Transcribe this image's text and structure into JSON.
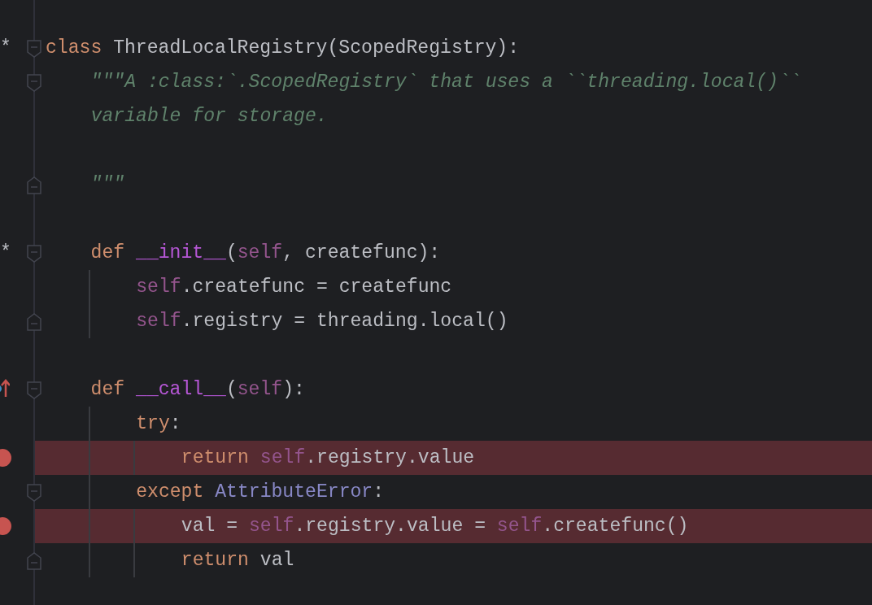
{
  "editor": {
    "lines": [
      {
        "kind": "code",
        "gutter": "*",
        "fold": {
          "kind": "start"
        },
        "tokens": [
          {
            "kind": "keyword",
            "text": "class"
          },
          {
            "kind": "plain",
            "text": " ThreadLocalRegistry(ScopedRegistry):"
          }
        ],
        "children": [
          {
            "kind": "code",
            "fold": {
              "kind": "start"
            },
            "tokens": [
              {
                "kind": "doc",
                "text": "\"\"\"A :class:`.ScopedRegistry` that uses a ``threading.local()``"
              }
            ]
          },
          {
            "kind": "code",
            "tokens": [
              {
                "kind": "doc",
                "text": "variable for storage."
              }
            ]
          },
          {
            "kind": "blank"
          },
          {
            "kind": "code",
            "fold": {
              "kind": "end"
            },
            "tokens": [
              {
                "kind": "doc",
                "text": "\"\"\""
              }
            ]
          },
          {
            "kind": "blank"
          },
          {
            "kind": "code",
            "gutter": "*",
            "fold": {
              "kind": "start"
            },
            "tokens": [
              {
                "kind": "keyword",
                "text": "def "
              },
              {
                "kind": "dunder",
                "text": "__init__"
              },
              {
                "kind": "plain",
                "text": "("
              },
              {
                "kind": "self",
                "text": "self"
              },
              {
                "kind": "plain",
                "text": ", createfunc):"
              }
            ],
            "children": [
              {
                "kind": "code",
                "tokens": [
                  {
                    "kind": "self",
                    "text": "self"
                  },
                  {
                    "kind": "plain",
                    "text": ".createfunc = createfunc"
                  }
                ]
              },
              {
                "kind": "code",
                "fold": {
                  "kind": "end"
                },
                "tokens": [
                  {
                    "kind": "self",
                    "text": "self"
                  },
                  {
                    "kind": "plain",
                    "text": ".registry = threading.local()"
                  }
                ]
              }
            ]
          },
          {
            "kind": "blank"
          },
          {
            "kind": "code",
            "marker": {
              "kind": "override"
            },
            "fold": {
              "kind": "start"
            },
            "tokens": [
              {
                "kind": "keyword",
                "text": "def "
              },
              {
                "kind": "dunder",
                "text": "__call__"
              },
              {
                "kind": "plain",
                "text": "("
              },
              {
                "kind": "self",
                "text": "self"
              },
              {
                "kind": "plain",
                "text": "):"
              }
            ],
            "children": [
              {
                "kind": "code",
                "tokens": [
                  {
                    "kind": "keyword",
                    "text": "try"
                  },
                  {
                    "kind": "plain",
                    "text": ":"
                  }
                ],
                "children": [
                  {
                    "kind": "code",
                    "marker": {
                      "kind": "breakpoint"
                    },
                    "tokens": [
                      {
                        "kind": "keyword",
                        "text": "return "
                      },
                      {
                        "kind": "self",
                        "text": "self"
                      },
                      {
                        "kind": "plain",
                        "text": ".registry.value"
                      }
                    ]
                  }
                ]
              },
              {
                "kind": "code",
                "fold": {
                  "kind": "start"
                },
                "tokens": [
                  {
                    "kind": "keyword",
                    "text": "except "
                  },
                  {
                    "kind": "builtin",
                    "text": "AttributeError"
                  },
                  {
                    "kind": "plain",
                    "text": ":"
                  }
                ],
                "children": [
                  {
                    "kind": "code",
                    "marker": {
                      "kind": "breakpoint"
                    },
                    "tokens": [
                      {
                        "kind": "plain",
                        "text": "val = "
                      },
                      {
                        "kind": "self",
                        "text": "self"
                      },
                      {
                        "kind": "plain",
                        "text": ".registry.value = "
                      },
                      {
                        "kind": "self",
                        "text": "self"
                      },
                      {
                        "kind": "plain",
                        "text": ".createfunc()"
                      }
                    ]
                  },
                  {
                    "kind": "code",
                    "fold": {
                      "kind": "end"
                    },
                    "tokens": [
                      {
                        "kind": "keyword",
                        "text": "return "
                      },
                      {
                        "kind": "plain",
                        "text": "val"
                      }
                    ]
                  }
                ]
              }
            ]
          }
        ]
      }
    ]
  }
}
